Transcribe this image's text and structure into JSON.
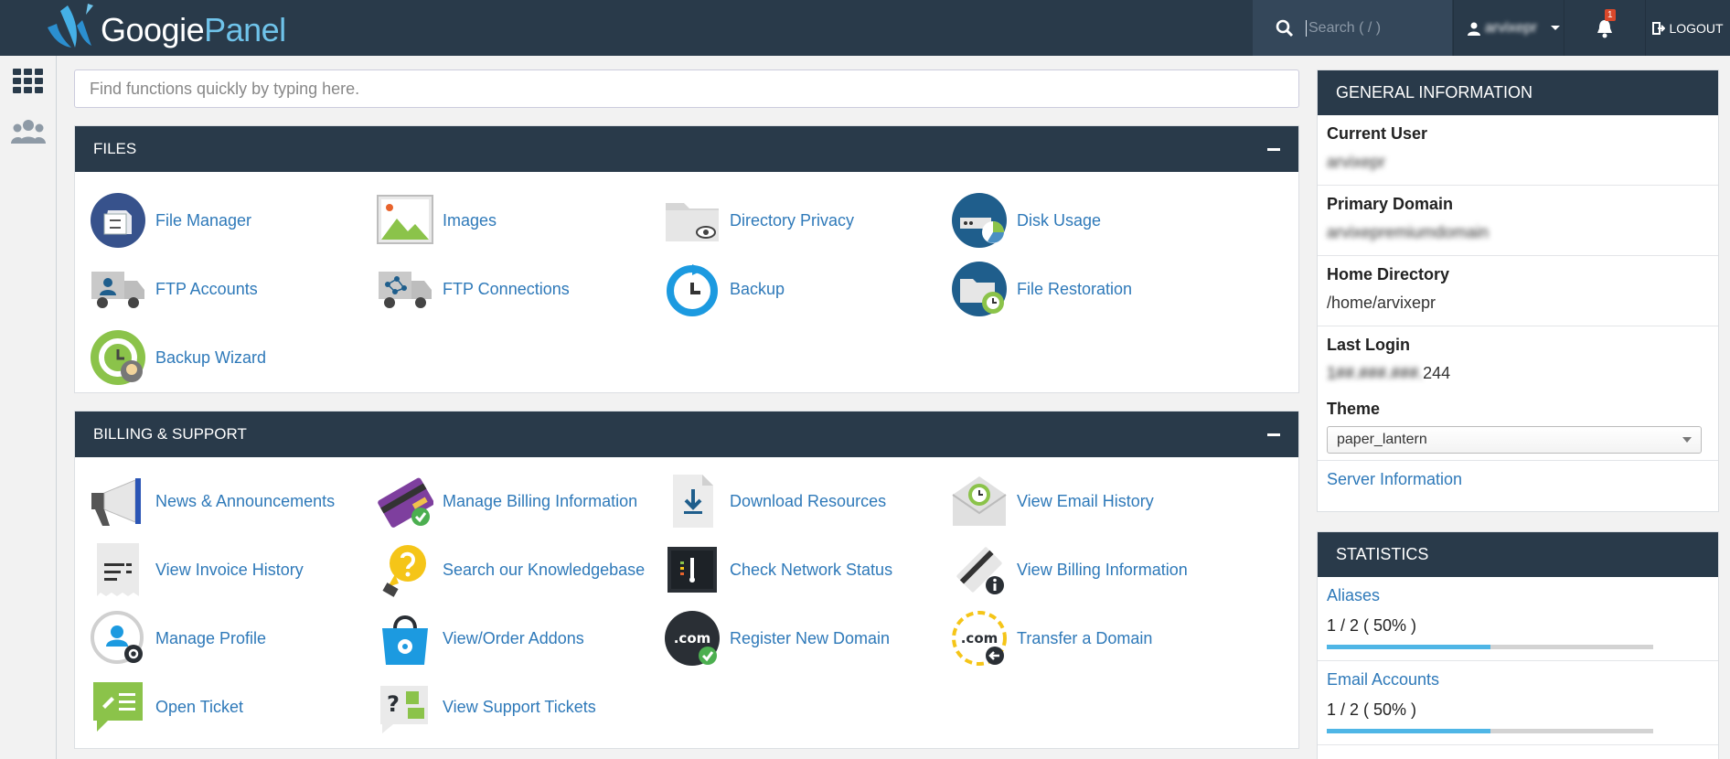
{
  "brand": {
    "logo_text_1": "Googie",
    "logo_text_2": "Panel"
  },
  "topbar": {
    "search_placeholder": "Search ( / )",
    "username": "arvixepr",
    "notification_count": "1",
    "logout_label": "LOGOUT"
  },
  "main": {
    "search_placeholder": "Find functions quickly by typing here."
  },
  "files": {
    "title": "FILES",
    "items": [
      {
        "label": "File Manager",
        "icon": "file-manager-icon"
      },
      {
        "label": "Images",
        "icon": "images-icon"
      },
      {
        "label": "Directory Privacy",
        "icon": "directory-privacy-icon"
      },
      {
        "label": "Disk Usage",
        "icon": "disk-usage-icon"
      },
      {
        "label": "FTP Accounts",
        "icon": "ftp-accounts-icon"
      },
      {
        "label": "FTP Connections",
        "icon": "ftp-connections-icon"
      },
      {
        "label": "Backup",
        "icon": "backup-icon"
      },
      {
        "label": "File Restoration",
        "icon": "file-restoration-icon"
      },
      {
        "label": "Backup Wizard",
        "icon": "backup-wizard-icon"
      }
    ]
  },
  "billing": {
    "title": "BILLING & SUPPORT",
    "items": [
      {
        "label": "News & Announcements",
        "icon": "megaphone-icon"
      },
      {
        "label": "Manage Billing Information",
        "icon": "credit-card-icon"
      },
      {
        "label": "Download Resources",
        "icon": "download-icon"
      },
      {
        "label": "View Email History",
        "icon": "email-history-icon"
      },
      {
        "label": "View Invoice History",
        "icon": "invoice-icon"
      },
      {
        "label": "Search our Knowledgebase",
        "icon": "lightbulb-icon"
      },
      {
        "label": "Check Network Status",
        "icon": "network-status-icon"
      },
      {
        "label": "View Billing Information",
        "icon": "billing-info-icon"
      },
      {
        "label": "Manage Profile",
        "icon": "profile-icon"
      },
      {
        "label": "View/Order Addons",
        "icon": "addons-bag-icon"
      },
      {
        "label": "Register New Domain",
        "icon": "register-domain-icon"
      },
      {
        "label": "Transfer a Domain",
        "icon": "transfer-domain-icon"
      },
      {
        "label": "Open Ticket",
        "icon": "open-ticket-icon"
      },
      {
        "label": "View Support Tickets",
        "icon": "support-tickets-icon"
      }
    ]
  },
  "general_info": {
    "title": "GENERAL INFORMATION",
    "current_user_label": "Current User",
    "current_user_value": "arvixepr",
    "primary_domain_label": "Primary Domain",
    "primary_domain_value": "arvixepremiumdomain",
    "home_directory_label": "Home Directory",
    "home_directory_value": "/home/arvixepr",
    "last_login_label": "Last Login",
    "last_login_value_hidden": "1##.###.###.",
    "last_login_value_suffix": "244",
    "theme_label": "Theme",
    "theme_value": "paper_lantern",
    "server_info_link": "Server Information"
  },
  "statistics": {
    "title": "STATISTICS",
    "items": [
      {
        "label": "Aliases",
        "value": "1 / 2 ( 50% )",
        "percent": 50
      },
      {
        "label": "Email Accounts",
        "value": "1 / 2 ( 50% )",
        "percent": 50
      }
    ]
  },
  "colors": {
    "header": "#293a4a",
    "link": "#2e79b9",
    "progress": "#4fb6e6"
  }
}
